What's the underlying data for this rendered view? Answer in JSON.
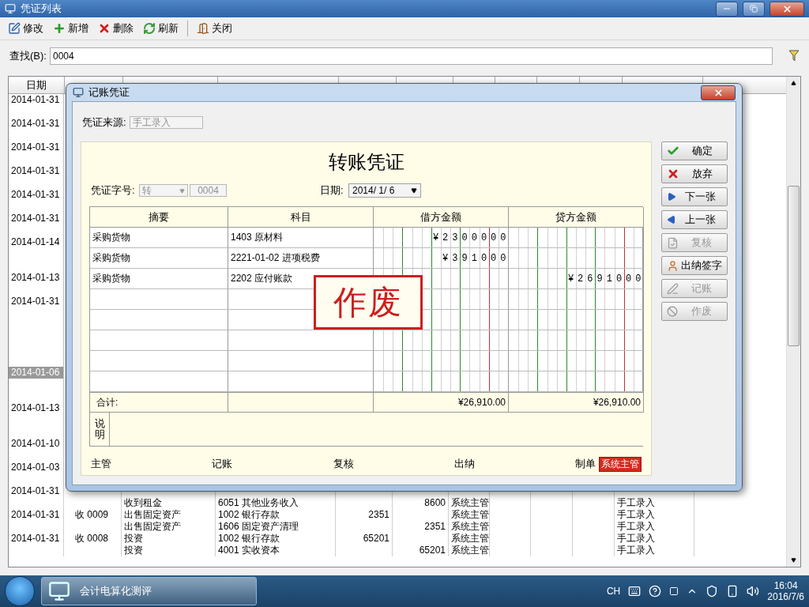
{
  "window": {
    "title": "凭证列表"
  },
  "toolbar": [
    {
      "label": "修改",
      "kind": "edit"
    },
    {
      "label": "新增",
      "kind": "add"
    },
    {
      "label": "删除",
      "kind": "delete"
    },
    {
      "label": "刷新",
      "kind": "refresh"
    },
    {
      "label": "关闭",
      "kind": "close"
    }
  ],
  "search": {
    "label": "查找(B):",
    "value": "0004"
  },
  "table": {
    "columns": [
      "日期"
    ],
    "rows": [
      {
        "date": "2014-01-31",
        "selected": false
      },
      {
        "date": "2014-01-31",
        "selected": false
      },
      {
        "date": "2014-01-31",
        "selected": false
      },
      {
        "date": "2014-01-31",
        "selected": false
      },
      {
        "date": "2014-01-31",
        "selected": false
      },
      {
        "date": "2014-01-31",
        "selected": false
      },
      {
        "date": "2014-01-14",
        "selected": false
      },
      {
        "date": "2014-01-13",
        "selected": false
      },
      {
        "date": "2014-01-31",
        "selected": false
      },
      {
        "date": "2014-01-06",
        "selected": true
      },
      {
        "date": "2014-01-13",
        "selected": false
      },
      {
        "date": "2014-01-10",
        "selected": false
      },
      {
        "date": "2014-01-03",
        "selected": false
      },
      {
        "date": "2014-01-31",
        "selected": false,
        "lines": [
          {
            "summary": "收到租金",
            "account": "6051 其他业务收入",
            "credit": "8600",
            "maker": "系统主管",
            "source": "手工录入"
          }
        ]
      },
      {
        "date": "2014-01-31",
        "selected": false,
        "voucher": "收 0009",
        "lines": [
          {
            "summary": "出售固定资产",
            "account": "1002 银行存款",
            "debit": "2351",
            "maker": "系统主管",
            "source": "手工录入"
          },
          {
            "summary": "出售固定资产",
            "account": "1606 固定资产清理",
            "credit": "2351",
            "maker": "系统主管",
            "source": "手工录入"
          }
        ]
      },
      {
        "date": "2014-01-31",
        "selected": false,
        "voucher": "收 0008",
        "lines": [
          {
            "summary": "投资",
            "account": "1002 银行存款",
            "debit": "65201",
            "maker": "系统主管",
            "source": "手工录入"
          },
          {
            "summary": "投资",
            "account": "4001 实收资本",
            "credit": "65201",
            "maker": "系统主管",
            "source": "手工录入"
          }
        ]
      }
    ]
  },
  "dialog": {
    "title": "记账凭证",
    "source_label": "凭证来源:",
    "source_value": "手工录入",
    "voucher_title": "转账凭证",
    "number_label": "凭证字号:",
    "word": "转",
    "number": "0004",
    "date_label": "日期:",
    "date": "2014/ 1/ 6",
    "columns": [
      "摘要",
      "科目",
      "借方金额",
      "贷方金额"
    ],
    "entries": [
      {
        "summary": "采购货物",
        "account": "1403 原材料",
        "debit": "¥2300000"
      },
      {
        "summary": "采购货物",
        "account": "2221-01-02 进项税费",
        "debit": "¥391000"
      },
      {
        "summary": "采购货物",
        "account": "2202 应付账款",
        "credit": "¥2691000"
      }
    ],
    "total_label": "合计:",
    "total_debit": "¥26,910.00",
    "total_credit": "¥26,910.00",
    "remark_label": "说明",
    "stamp": "作废",
    "signatures": [
      {
        "role": "主管"
      },
      {
        "role": "记账"
      },
      {
        "role": "复核"
      },
      {
        "role": "出纳"
      },
      {
        "role": "制单",
        "name": "系统主管"
      }
    ],
    "buttons": [
      {
        "label": "确定",
        "kind": "ok",
        "disabled": false
      },
      {
        "label": "放弃",
        "kind": "cancel",
        "disabled": false
      },
      {
        "label": "下一张",
        "kind": "next",
        "disabled": false
      },
      {
        "label": "上一张",
        "kind": "prev",
        "disabled": false
      },
      {
        "label": "复核",
        "kind": "review",
        "disabled": true
      },
      {
        "label": "出纳签字",
        "kind": "sign",
        "disabled": false
      },
      {
        "label": "记账",
        "kind": "post",
        "disabled": true
      },
      {
        "label": "作废",
        "kind": "void",
        "disabled": true
      }
    ]
  },
  "taskbar": {
    "app": "会计电算化测评",
    "lang": "CH",
    "time": "16:04",
    "date": "2016/7/6"
  }
}
